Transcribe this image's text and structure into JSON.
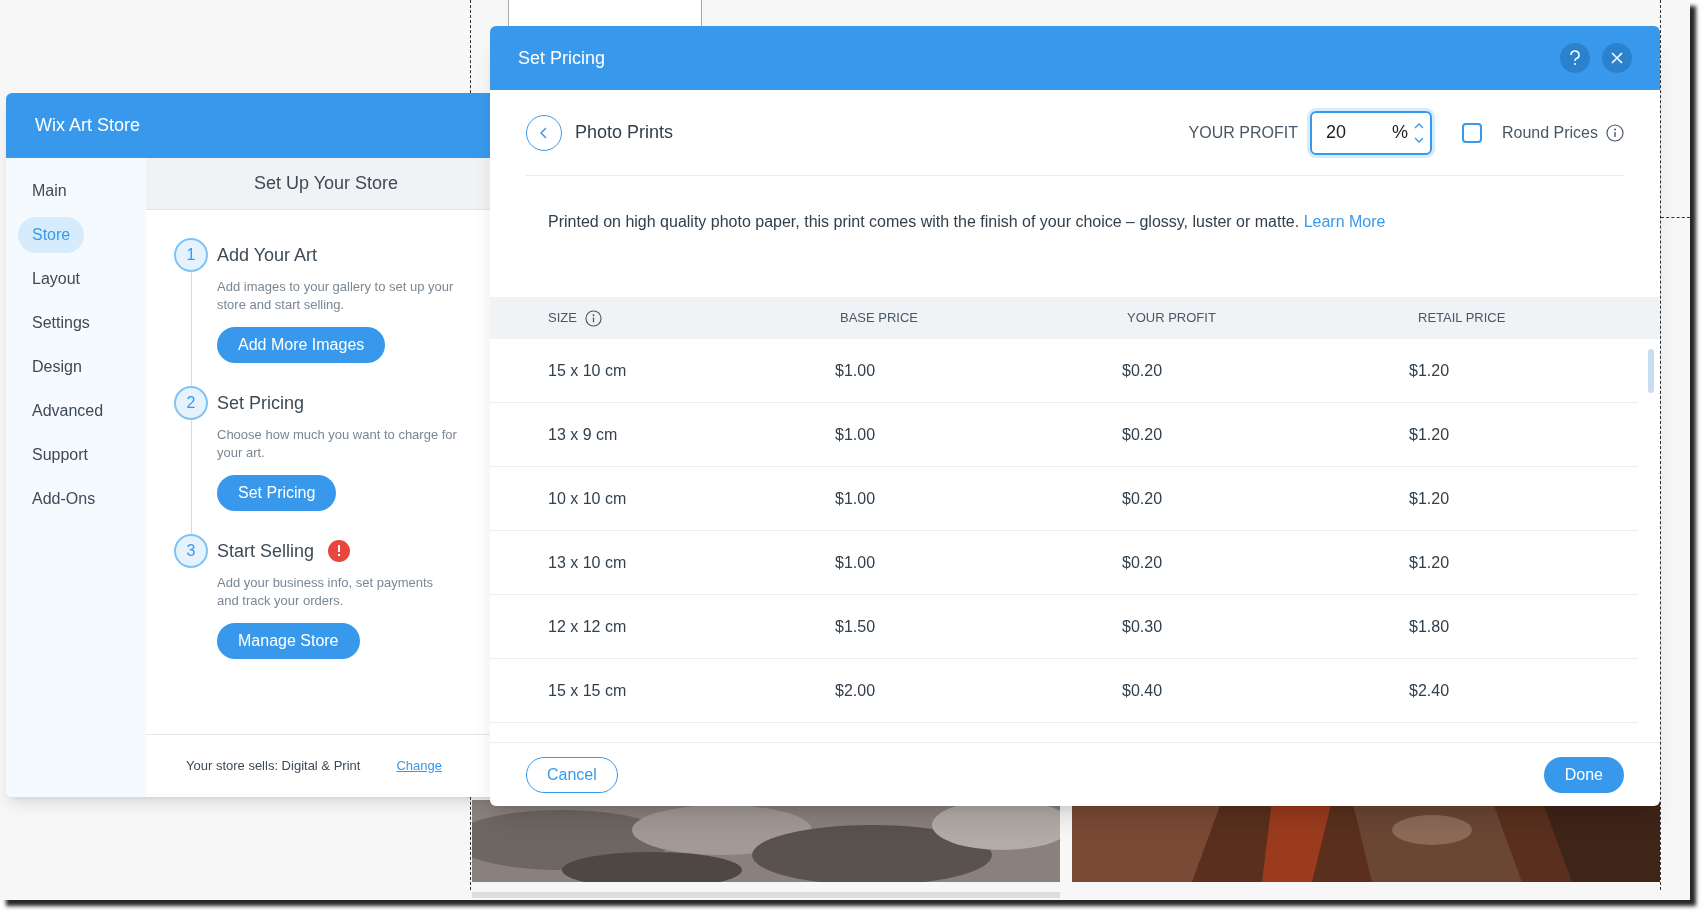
{
  "store_panel": {
    "title": "Wix Art Store",
    "nav": [
      {
        "label": "Main",
        "selected": false
      },
      {
        "label": "Store",
        "selected": true
      },
      {
        "label": "Layout",
        "selected": false
      },
      {
        "label": "Settings",
        "selected": false
      },
      {
        "label": "Design",
        "selected": false
      },
      {
        "label": "Advanced",
        "selected": false
      },
      {
        "label": "Support",
        "selected": false
      },
      {
        "label": "Add-Ons",
        "selected": false
      }
    ],
    "heading": "Set Up Your Store",
    "steps": [
      {
        "number": "1",
        "title": "Add Your Art",
        "alert": false,
        "description": "Add images to your gallery to set up your store and start selling.",
        "button": "Add More Images"
      },
      {
        "number": "2",
        "title": "Set Pricing",
        "alert": false,
        "description": "Choose how much you want to charge for your art.",
        "button": "Set Pricing"
      },
      {
        "number": "3",
        "title": "Start Selling",
        "alert": true,
        "description": "Add your business info, set payments and track your orders.",
        "button": "Manage Store"
      }
    ],
    "footer": {
      "text": "Your store sells: Digital & Print",
      "link": "Change"
    }
  },
  "pricing_dialog": {
    "title": "Set Pricing",
    "product": "Photo Prints",
    "profit_label": "YOUR PROFIT",
    "profit_value": "20",
    "profit_unit": "%",
    "round_prices": {
      "label": "Round Prices",
      "checked": false
    },
    "description": "Printed on high quality photo paper, this print comes with the finish of your choice – glossy, luster or matte.",
    "learn_more": "Learn More",
    "table": {
      "columns": [
        "SIZE",
        "BASE PRICE",
        "YOUR PROFIT",
        "RETAIL PRICE"
      ],
      "rows": [
        [
          "15 x 10 cm",
          "$1.00",
          "$0.20",
          "$1.20"
        ],
        [
          "13 x 9 cm",
          "$1.00",
          "$0.20",
          "$1.20"
        ],
        [
          "10 x 10 cm",
          "$1.00",
          "$0.20",
          "$1.20"
        ],
        [
          "13 x 10 cm",
          "$1.00",
          "$0.20",
          "$1.20"
        ],
        [
          "12 x 12 cm",
          "$1.50",
          "$0.30",
          "$1.80"
        ],
        [
          "15 x 15 cm",
          "$2.00",
          "$0.40",
          "$2.40"
        ]
      ]
    },
    "cancel": "Cancel",
    "done": "Done"
  }
}
